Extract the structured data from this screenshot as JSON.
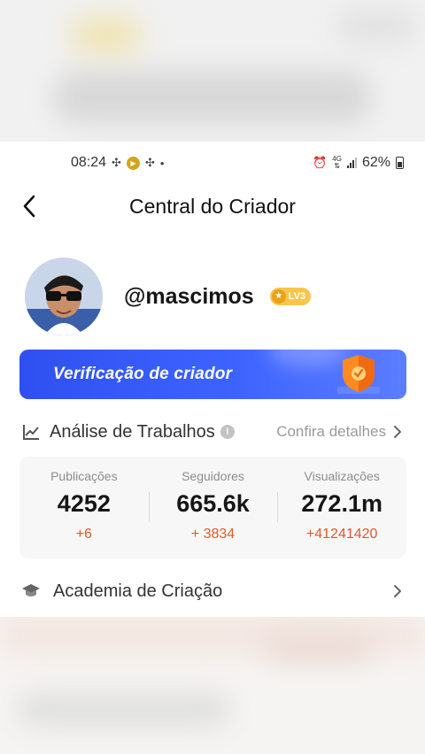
{
  "status_bar": {
    "time": "08:24",
    "battery": "62%",
    "network": "4G",
    "icons": [
      "pinwheel-icon",
      "youtube-icon",
      "pinwheel-icon",
      "dot-icon",
      "alarm-icon",
      "signal-icon",
      "battery-icon"
    ]
  },
  "header": {
    "title": "Central do Criador",
    "back_icon": "chevron-left-icon"
  },
  "profile": {
    "username": "@mascimos",
    "level_badge": "LV3"
  },
  "banner": {
    "text": "Verificação de criador",
    "icon": "shield-icon",
    "colors": {
      "start": "#2f50f0",
      "end": "#5b7dff"
    }
  },
  "analysis": {
    "title": "Análise de Trabalhos",
    "info_icon": "info-icon",
    "link_label": "Confira detalhes"
  },
  "stats": [
    {
      "label": "Publicações",
      "value": "4252",
      "delta": "+6"
    },
    {
      "label": "Seguidores",
      "value": "665.6k",
      "delta": "+ 3834"
    },
    {
      "label": "Visualizações",
      "value": "272.1m",
      "delta": "+41241420"
    }
  ],
  "academy": {
    "title": "Academia de Criação",
    "icon": "graduation-cap-icon"
  },
  "colors": {
    "accent_orange": "#e0582c",
    "badge_gold": "#f7c64b",
    "banner_blue": "#3d63ff"
  }
}
